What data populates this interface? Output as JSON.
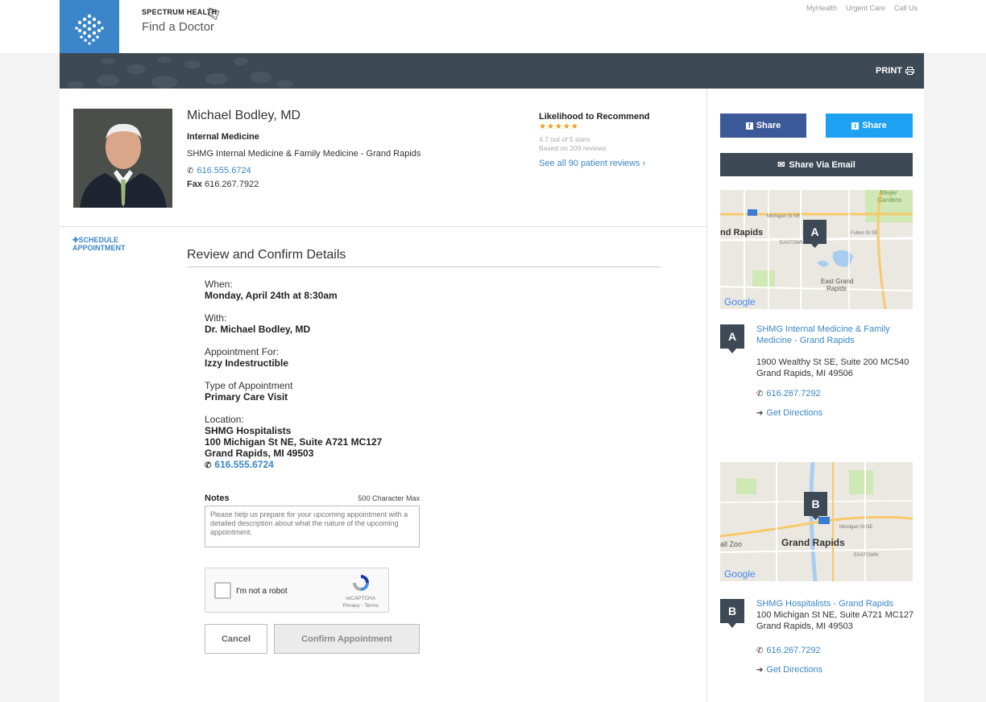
{
  "header": {
    "brand_name": "SPECTRUM HEALTH",
    "brand_tagline": "Find a Doctor",
    "utility_links": [
      "MyHealth",
      "Urgent Care",
      "Call Us"
    ],
    "print_label": "PRINT"
  },
  "doctor": {
    "name": "Michael Bodley, MD",
    "specialty": "Internal Medicine",
    "practice": "SHMG Internal Medicine & Family Medicine - Grand Rapids",
    "phone": "616.555.6724",
    "fax_label": "Fax",
    "fax": "616.267.7922"
  },
  "recommend": {
    "title": "Likelihood to Recommend",
    "stars": "★★★★★",
    "rating_text": "4.7 out of 5 stars",
    "reviews_text": "Based on 209 reviews",
    "link": "See all 90 patient reviews ›",
    "star_color": "#f39c12"
  },
  "sidebar_left": {
    "schedule_line1": "SCHEDULE",
    "schedule_line2": "APPOINTMENT"
  },
  "review": {
    "title": "Review and Confirm Details",
    "when_label": "When:",
    "when_value": "Monday, April 24th at 8:30am",
    "with_label": "With:",
    "with_value": "Dr. Michael Bodley, MD",
    "for_label": "Appointment For:",
    "for_value": "Izzy Indestructible",
    "type_label": "Type of Appointment",
    "type_value": "Primary Care Visit",
    "location_label": "Location:",
    "location_name": "SHMG Hospitalists",
    "location_street": "100 Michigan St NE, Suite A721 MC127",
    "location_city": "Grand Rapids, MI 49503",
    "location_phone": "616.555.6724"
  },
  "notes": {
    "label": "Notes",
    "max": "500 Character Max",
    "placeholder": "Please help us prepare for your upcoming appointment with a detailed description about what the nature of the upcoming appointment."
  },
  "captcha": {
    "label": "I'm not a robot",
    "brand": "reCAPTCHA",
    "links": "Privacy - Terms"
  },
  "buttons": {
    "cancel": "Cancel",
    "confirm": "Confirm Appointment"
  },
  "share": {
    "facebook": "Share",
    "twitter": "Share",
    "email": "Share Via Email"
  },
  "locations": [
    {
      "pin": "A",
      "name": "SHMG Internal Medicine & Family Medicine - Grand Rapids",
      "address1": "1900 Wealthy St SE, Suite 200 MC540",
      "address2": "Grand Rapids, MI 49506",
      "phone": "616.267.7292",
      "directions": "Get Directions",
      "map_labels": {
        "city": "nd Rapids",
        "area": "East Grand Rapids",
        "area1": "East Grand",
        "area2": "Rapids",
        "park1": "Meijer",
        "park2": "Gardens",
        "street1": "Michigan St NE",
        "street2": "Fulton St SE",
        "district": "EASTOWN",
        "google": "Google"
      }
    },
    {
      "pin": "B",
      "name": "SHMG Hospitalists - Grand Rapids",
      "address1": "100 Michigan St NE, Suite A721 MC127",
      "address2": "Grand Rapids, MI 49503",
      "phone": "616.267.7292",
      "directions": "Get Directions",
      "map_labels": {
        "city": "Grand Rapids",
        "zoo": "all Zoo",
        "district": "EASTOWN",
        "street1": "Michigan St NE",
        "google": "Google"
      }
    }
  ],
  "colors": {
    "accent": "#3a86c8",
    "dark": "#3d4a56",
    "facebook": "#3b5998",
    "twitter": "#1da1f2"
  }
}
